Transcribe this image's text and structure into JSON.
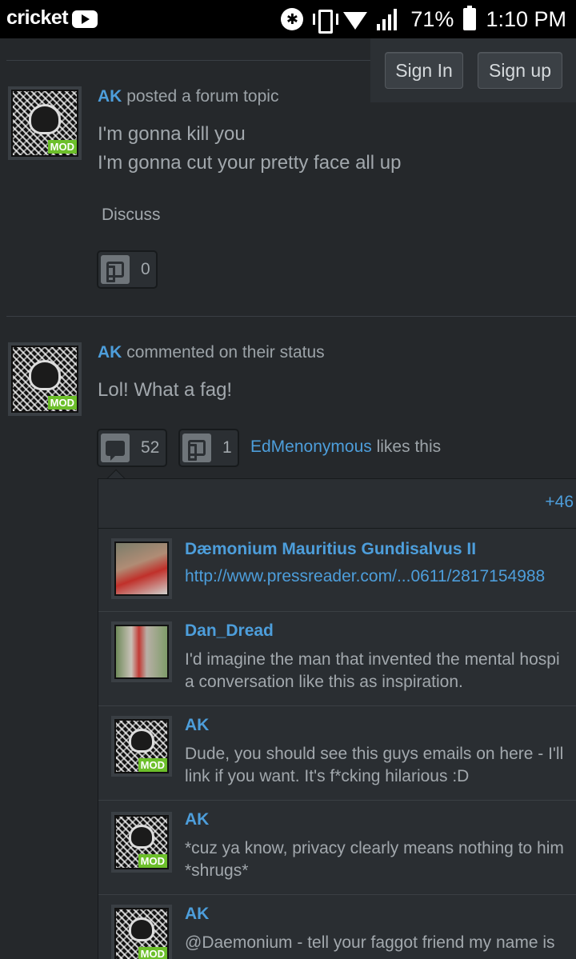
{
  "status_bar": {
    "carrier": "cricket",
    "battery": "71%",
    "time": "1:10 PM",
    "icons": [
      "youtube-icon",
      "bluetooth-icon",
      "vibrate-icon",
      "wifi-icon",
      "signal-icon",
      "battery-icon"
    ]
  },
  "auth": {
    "sign_in": "Sign In",
    "sign_up": "Sign up"
  },
  "feed": [
    {
      "user": "AK",
      "badge": "MOD",
      "action": "posted a forum topic",
      "title": "I'm gonna kill you",
      "body": "I'm gonna cut your pretty face all up",
      "discuss": "Discuss",
      "likes": "0"
    },
    {
      "user": "AK",
      "badge": "MOD",
      "action": "commented on their status",
      "body": "Lol! What a fag!",
      "comment_count": "52",
      "likes": "1",
      "liked_by": "EdMenonymous",
      "likes_suffix": "likes this"
    }
  ],
  "comments": {
    "more": "+46",
    "items": [
      {
        "user": "Dæmonium Mauritius Gundisalvus II",
        "line1": "http://www.pressreader.com/...0611/2817154988",
        "line2": ""
      },
      {
        "user": "Dan_Dread",
        "line1": "I'd imagine the man that invented the mental hospi",
        "line2": "a conversation like this as inspiration."
      },
      {
        "user": "AK",
        "badge": "MOD",
        "line1": "Dude, you should see this guys emails on here - I'll",
        "line2": "link if you want. It's f*cking hilarious :D"
      },
      {
        "user": "AK",
        "badge": "MOD",
        "line1": "*cuz ya know, privacy clearly means nothing to him",
        "line2": "*shrugs*"
      },
      {
        "user": "AK",
        "badge": "MOD",
        "line1": "@Daemonium - tell your faggot friend my name is",
        "line2": ""
      }
    ]
  },
  "colors": {
    "background": "#25282b",
    "link": "#4d9edb",
    "mod_badge": "#6cbf2a"
  }
}
